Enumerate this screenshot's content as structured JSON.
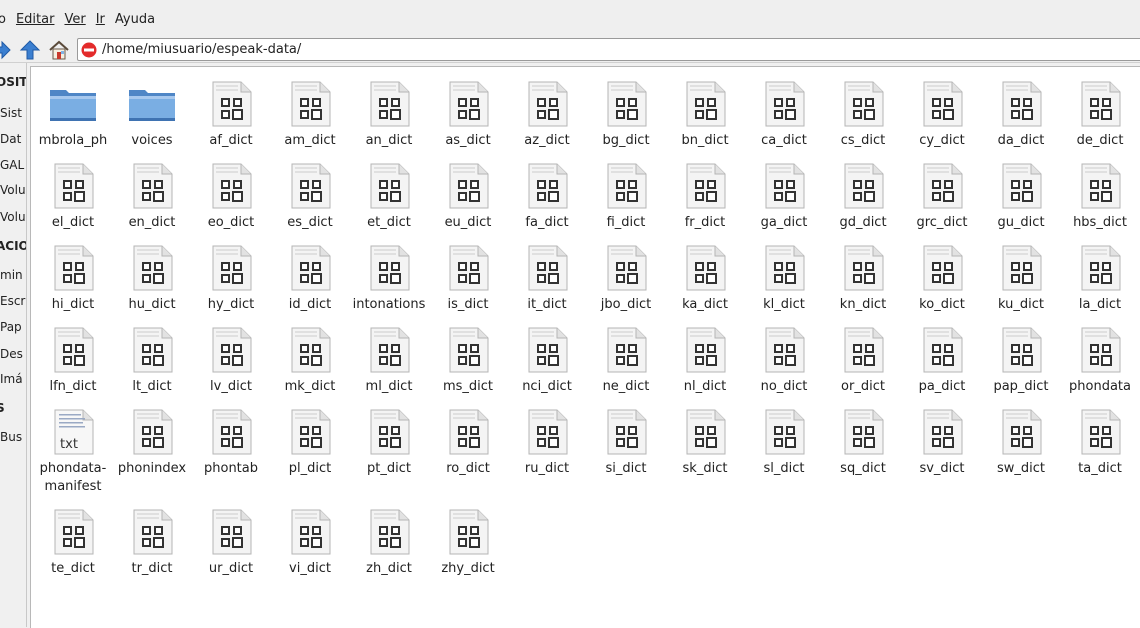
{
  "menu": [
    "o",
    "Editar",
    "Ver",
    "Ir",
    "Ayuda"
  ],
  "address": {
    "path": "/home/miusuario/espeak-data/"
  },
  "sidebar": {
    "items": [
      "OSITI",
      "Sist",
      "Dat",
      "GAL",
      "Volu",
      "Volu",
      "ACIO",
      "min",
      "Escr",
      "Pap",
      "Des",
      "Imá",
      "S",
      "Bus"
    ]
  },
  "files": [
    {
      "name": "mbrola_ph",
      "type": "folder"
    },
    {
      "name": "voices",
      "type": "folder"
    },
    {
      "name": "af_dict",
      "type": "binary"
    },
    {
      "name": "am_dict",
      "type": "binary"
    },
    {
      "name": "an_dict",
      "type": "binary"
    },
    {
      "name": "as_dict",
      "type": "binary"
    },
    {
      "name": "az_dict",
      "type": "binary"
    },
    {
      "name": "bg_dict",
      "type": "binary"
    },
    {
      "name": "bn_dict",
      "type": "binary"
    },
    {
      "name": "ca_dict",
      "type": "binary"
    },
    {
      "name": "cs_dict",
      "type": "binary"
    },
    {
      "name": "cy_dict",
      "type": "binary"
    },
    {
      "name": "da_dict",
      "type": "binary"
    },
    {
      "name": "de_dict",
      "type": "binary"
    },
    {
      "name": "el_dict",
      "type": "binary"
    },
    {
      "name": "en_dict",
      "type": "binary"
    },
    {
      "name": "eo_dict",
      "type": "binary"
    },
    {
      "name": "es_dict",
      "type": "binary"
    },
    {
      "name": "et_dict",
      "type": "binary"
    },
    {
      "name": "eu_dict",
      "type": "binary"
    },
    {
      "name": "fa_dict",
      "type": "binary"
    },
    {
      "name": "fi_dict",
      "type": "binary"
    },
    {
      "name": "fr_dict",
      "type": "binary"
    },
    {
      "name": "ga_dict",
      "type": "binary"
    },
    {
      "name": "gd_dict",
      "type": "binary"
    },
    {
      "name": "grc_dict",
      "type": "binary"
    },
    {
      "name": "gu_dict",
      "type": "binary"
    },
    {
      "name": "hbs_dict",
      "type": "binary"
    },
    {
      "name": "hi_dict",
      "type": "binary"
    },
    {
      "name": "hu_dict",
      "type": "binary"
    },
    {
      "name": "hy_dict",
      "type": "binary"
    },
    {
      "name": "id_dict",
      "type": "binary"
    },
    {
      "name": "intonations",
      "type": "binary"
    },
    {
      "name": "is_dict",
      "type": "binary"
    },
    {
      "name": "it_dict",
      "type": "binary"
    },
    {
      "name": "jbo_dict",
      "type": "binary"
    },
    {
      "name": "ka_dict",
      "type": "binary"
    },
    {
      "name": "kl_dict",
      "type": "binary"
    },
    {
      "name": "kn_dict",
      "type": "binary"
    },
    {
      "name": "ko_dict",
      "type": "binary"
    },
    {
      "name": "ku_dict",
      "type": "binary"
    },
    {
      "name": "la_dict",
      "type": "binary"
    },
    {
      "name": "lfn_dict",
      "type": "binary"
    },
    {
      "name": "lt_dict",
      "type": "binary"
    },
    {
      "name": "lv_dict",
      "type": "binary"
    },
    {
      "name": "mk_dict",
      "type": "binary"
    },
    {
      "name": "ml_dict",
      "type": "binary"
    },
    {
      "name": "ms_dict",
      "type": "binary"
    },
    {
      "name": "nci_dict",
      "type": "binary"
    },
    {
      "name": "ne_dict",
      "type": "binary"
    },
    {
      "name": "nl_dict",
      "type": "binary"
    },
    {
      "name": "no_dict",
      "type": "binary"
    },
    {
      "name": "or_dict",
      "type": "binary"
    },
    {
      "name": "pa_dict",
      "type": "binary"
    },
    {
      "name": "pap_dict",
      "type": "binary"
    },
    {
      "name": "phondata",
      "type": "binary"
    },
    {
      "name": "phondata-manifest",
      "type": "text",
      "badge": "txt"
    },
    {
      "name": "phonindex",
      "type": "binary"
    },
    {
      "name": "phontab",
      "type": "binary"
    },
    {
      "name": "pl_dict",
      "type": "binary"
    },
    {
      "name": "pt_dict",
      "type": "binary"
    },
    {
      "name": "ro_dict",
      "type": "binary"
    },
    {
      "name": "ru_dict",
      "type": "binary"
    },
    {
      "name": "si_dict",
      "type": "binary"
    },
    {
      "name": "sk_dict",
      "type": "binary"
    },
    {
      "name": "sl_dict",
      "type": "binary"
    },
    {
      "name": "sq_dict",
      "type": "binary"
    },
    {
      "name": "sv_dict",
      "type": "binary"
    },
    {
      "name": "sw_dict",
      "type": "binary"
    },
    {
      "name": "ta_dict",
      "type": "binary"
    },
    {
      "name": "te_dict",
      "type": "binary"
    },
    {
      "name": "tr_dict",
      "type": "binary"
    },
    {
      "name": "ur_dict",
      "type": "binary"
    },
    {
      "name": "vi_dict",
      "type": "binary"
    },
    {
      "name": "zh_dict",
      "type": "binary"
    },
    {
      "name": "zhy_dict",
      "type": "binary"
    }
  ]
}
